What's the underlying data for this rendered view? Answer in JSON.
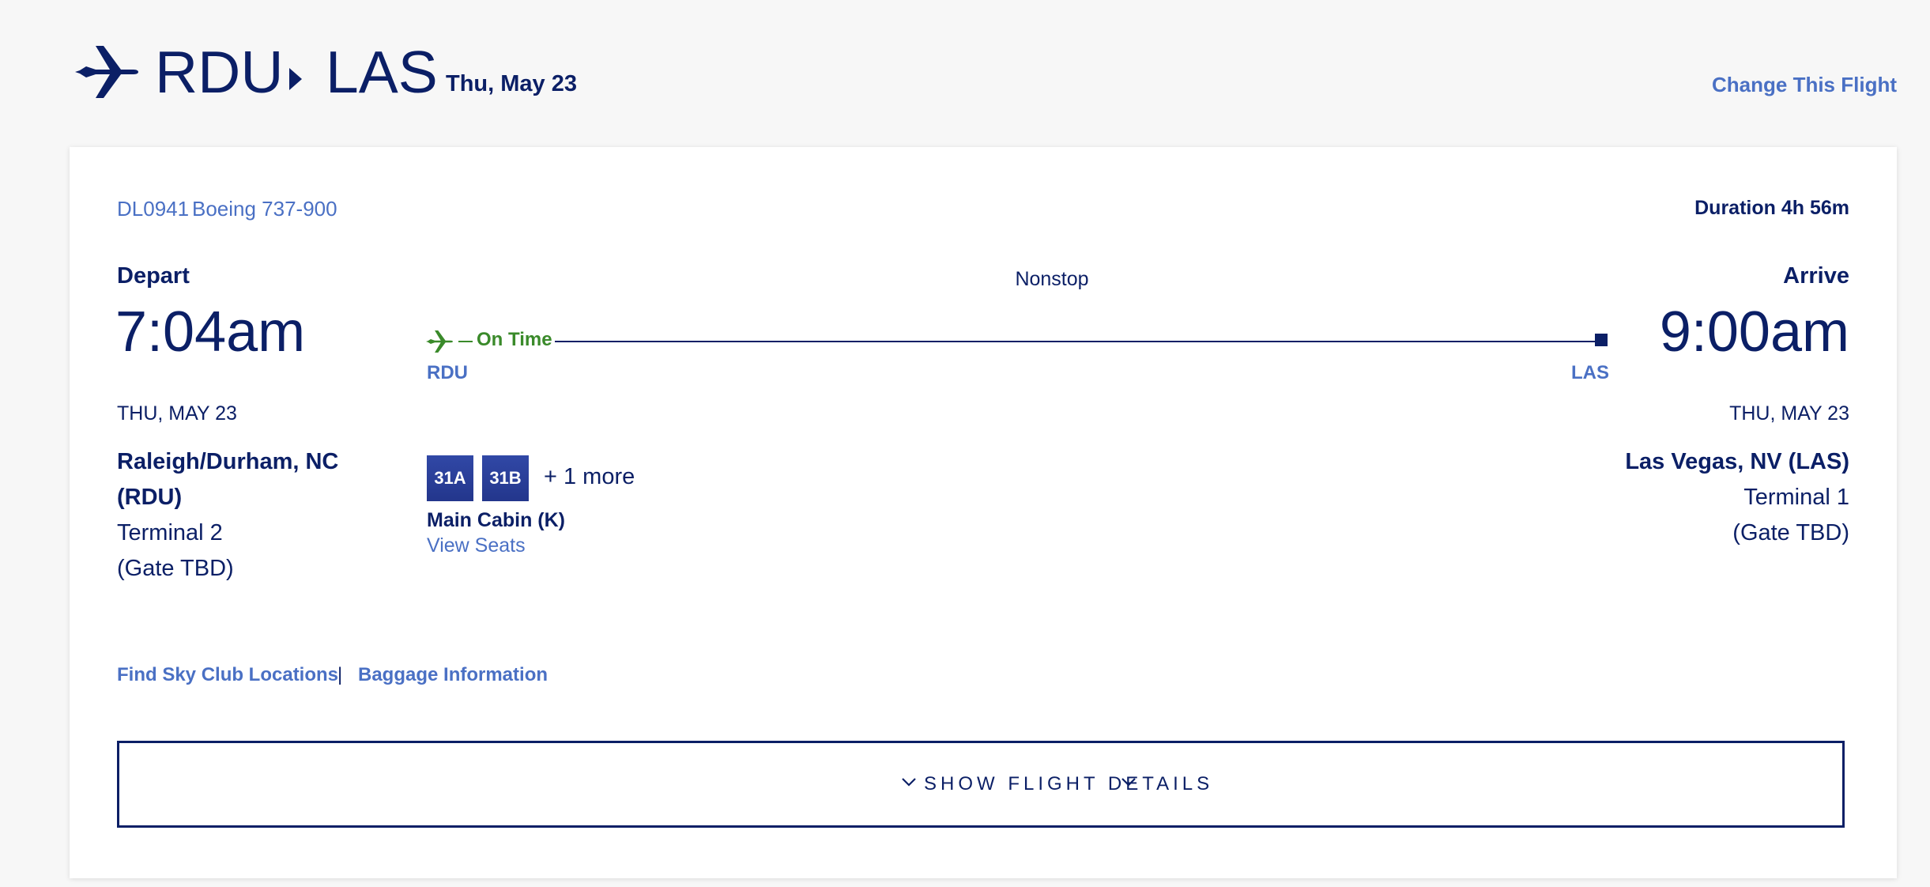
{
  "header": {
    "plane_icon": "airplane-icon",
    "origin": "RDU",
    "destination": "LAS",
    "date": "Thu, May 23",
    "change_link": "Change This Flight"
  },
  "flight": {
    "number": "DL0941",
    "aircraft": "Boeing 737-900",
    "duration": "Duration 4h 56m",
    "nonstop": "Nonstop",
    "status": "On Time",
    "status_color": "#3a8a2a",
    "origin_code": "RDU",
    "destination_code": "LAS"
  },
  "depart": {
    "label": "Depart",
    "time": "7:04am",
    "date": "THU, MAY 23",
    "city": "Raleigh/Durham, NC (RDU)",
    "terminal": "Terminal 2",
    "gate": "(Gate TBD)"
  },
  "arrive": {
    "label": "Arrive",
    "time": "9:00am",
    "date": "THU, MAY 23",
    "city": "Las Vegas, NV (LAS)",
    "terminal": "Terminal 1",
    "gate": "(Gate TBD)"
  },
  "seats": {
    "items": [
      "31A",
      "31B"
    ],
    "more": "+ 1 more",
    "cabin": "Main Cabin (K)",
    "view_link": "View Seats"
  },
  "links": {
    "sky_club": "Find Sky Club Locations",
    "divider": "|",
    "baggage": "Baggage Information"
  },
  "details_button": {
    "label": "SHOW FLIGHT DETAILS",
    "icon": "chevron-down-icon"
  },
  "colors": {
    "navy": "#0b1f66",
    "link_blue": "#4a70c4",
    "status_green": "#3a8a2a",
    "background": "#f7f7f7"
  }
}
